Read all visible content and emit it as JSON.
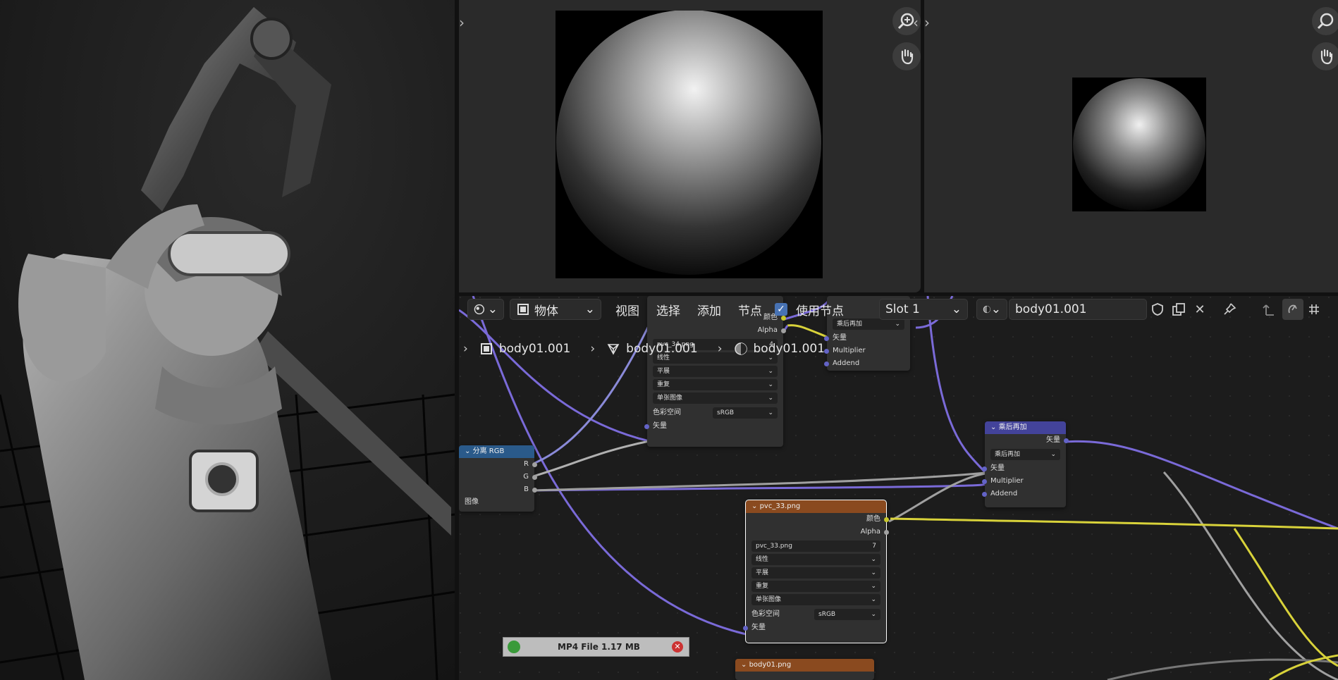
{
  "colors": {
    "node_blue_header": "#2a5a8a",
    "node_orange_header": "#8a4a1f",
    "node_purple_header": "#43439a",
    "link_yellow": "#d8d23a",
    "link_purple": "#7a6ad8",
    "link_gray": "#a0a0a0",
    "accent_checkbox": "#4772b3"
  },
  "header": {
    "mode_label": "物体",
    "menus": [
      "视图",
      "选择",
      "添加",
      "节点"
    ],
    "use_nodes_label": "使用节点",
    "slot_label": "Slot 1",
    "material_name": "body01.001"
  },
  "breadcrumbs": [
    "body01.001",
    "body01.001",
    "body01.001"
  ],
  "nodes": {
    "separate_rgb": {
      "title": "分离 RGB",
      "outputs": [
        "R",
        "G",
        "B"
      ],
      "input": "图像"
    },
    "pvc34": {
      "outputs": [
        "颜色",
        "Alpha"
      ],
      "image_name": "pvc_34.png",
      "image_users": "4",
      "interpolation": "线性",
      "projection": "平展",
      "extension": "重复",
      "source": "单张图像",
      "colorspace_label": "色彩空间",
      "colorspace_value": "sRGB",
      "vector_input": "矢量"
    },
    "multiply_add_top": {
      "title": "乘后再加",
      "inputs": [
        "矢量",
        "Multiplier",
        "Addend"
      ]
    },
    "multiply_add": {
      "title": "乘后再加",
      "output": "矢量",
      "operation": "乘后再加",
      "inputs": [
        "矢量",
        "Multiplier",
        "Addend"
      ]
    },
    "pvc33": {
      "title": "pvc_33.png",
      "outputs": [
        "颜色",
        "Alpha"
      ],
      "image_name": "pvc_33.png",
      "image_users": "7",
      "interpolation": "线性",
      "projection": "平展",
      "extension": "重复",
      "source": "单张图像",
      "colorspace_label": "色彩空间",
      "colorspace_value": "sRGB",
      "vector_input": "矢量"
    },
    "body01": {
      "title": "body01.png"
    }
  },
  "notification": {
    "text": "MP4 File 1.17 MB"
  },
  "icons": [
    "zoom-in-icon",
    "hand-pan-icon",
    "pin-icon",
    "shield-icon",
    "duplicate-icon",
    "close-icon",
    "checkbox-icon"
  ]
}
